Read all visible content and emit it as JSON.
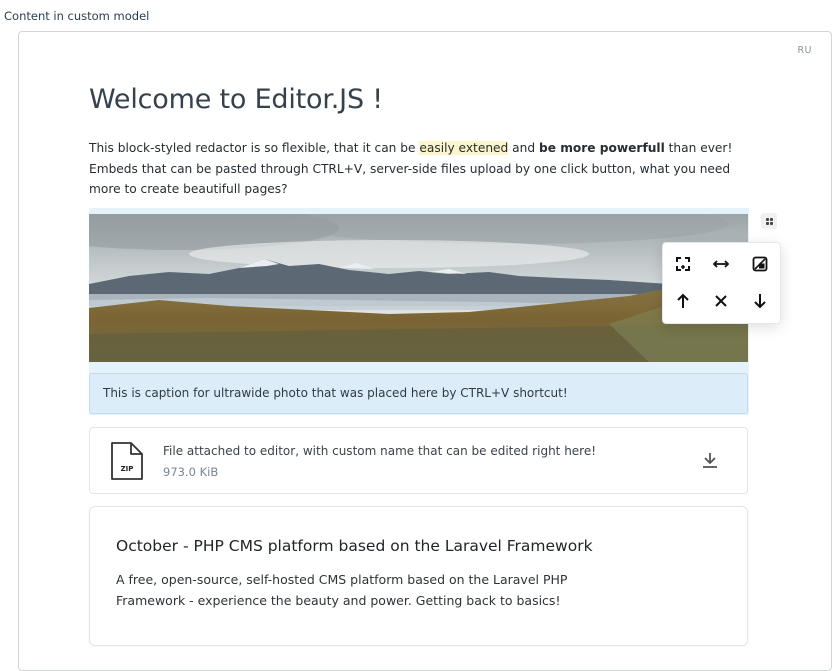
{
  "field": {
    "label": "Content in custom model"
  },
  "editor": {
    "language_badge": "RU",
    "heading": "Welcome to Editor.JS !",
    "paragraph": {
      "part1": "This block-styled redactor is so flexible, that it can be ",
      "marked": "easily extened",
      "part2": " and ",
      "bold": "be more powerfull",
      "part3": " than ever! Embeds that can be pasted through CTRL+V, server-side files upload by one click button, what you need more to create beautifull pages?"
    },
    "image_block": {
      "caption": "This is caption for ultrawide photo that was placed here by CTRL+V shortcut!",
      "tools": [
        {
          "icon": "border-icon"
        },
        {
          "icon": "stretch-icon"
        },
        {
          "icon": "background-icon"
        },
        {
          "icon": "arrow-up-icon"
        },
        {
          "icon": "close-icon"
        },
        {
          "icon": "arrow-down-icon"
        }
      ]
    },
    "attachment": {
      "file_type": "ZIP",
      "name": "File attached to editor, with custom name that can be edited right here!",
      "size": "973.0 KiB",
      "icon": "download-icon"
    },
    "link_card": {
      "title": "October - PHP CMS platform based on the Laravel Framework",
      "description": "A free, open-source, self-hosted CMS platform based on the Laravel PHP Framework - experience the beauty and power. Getting back to basics!"
    }
  },
  "colors": {
    "selection_bg": "#e6f2fb",
    "caption_bg": "#dcedf9",
    "mark_bg": "#fcf4cb"
  }
}
